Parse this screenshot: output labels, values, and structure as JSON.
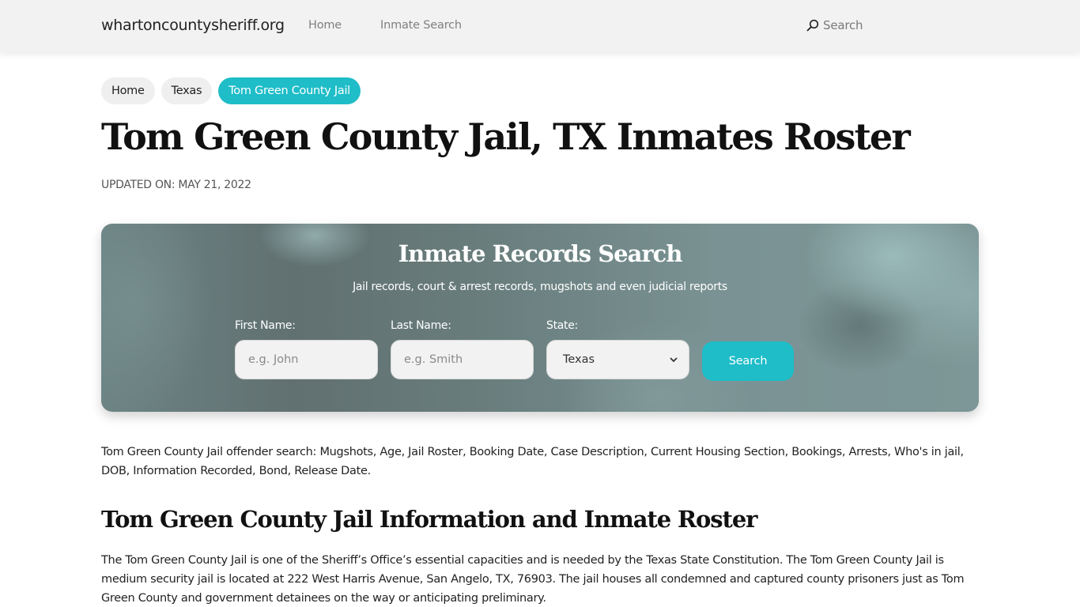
{
  "nav": {
    "brand": "whartoncountysheriff.org",
    "links": [
      {
        "label": "Home"
      },
      {
        "label": "Inmate Search"
      }
    ],
    "search_label": "Search",
    "search_icon": "search-icon"
  },
  "breadcrumb": [
    {
      "label": "Home"
    },
    {
      "label": "Texas"
    },
    {
      "label": "Tom Green County Jail",
      "active": true
    }
  ],
  "page": {
    "title": "Tom Green County Jail, TX Inmates Roster",
    "updated": "UPDATED ON: MAY 21, 2022"
  },
  "search_panel": {
    "title": "Inmate Records Search",
    "subtitle": "Jail records, court & arrest records, mugshots and even judicial reports",
    "first_name": {
      "label": "First Name:",
      "placeholder": "e.g. John",
      "value": ""
    },
    "last_name": {
      "label": "Last Name:",
      "placeholder": "e.g. Smith",
      "value": ""
    },
    "state": {
      "label": "State:",
      "selected": "Texas"
    },
    "button_label": "Search"
  },
  "content": {
    "intro": "Tom Green County Jail offender search: Mugshots, Age, Jail Roster, Booking Date, Case Description, Current Housing Section, Bookings, Arrests, Who's in jail, DOB, Information Recorded, Bond, Release Date.",
    "section_title": "Tom Green County Jail Information and Inmate Roster",
    "paragraph": "The Tom Green County Jail is one of the Sheriff’s Office’s essential capacities and is needed by the Texas State Constitution. The Tom Green County Jail is medium security jail is located at 222 West Harris Avenue, San Angelo, TX, 76903. The jail houses all condemned and captured county prisoners just as Tom Green County and government detainees on the way or anticipating preliminary."
  },
  "colors": {
    "accent": "#1ebdc8",
    "navbar_bg": "#f2f2f2",
    "crumb_bg": "#efefef",
    "panel_base": "#6a7e7e"
  }
}
